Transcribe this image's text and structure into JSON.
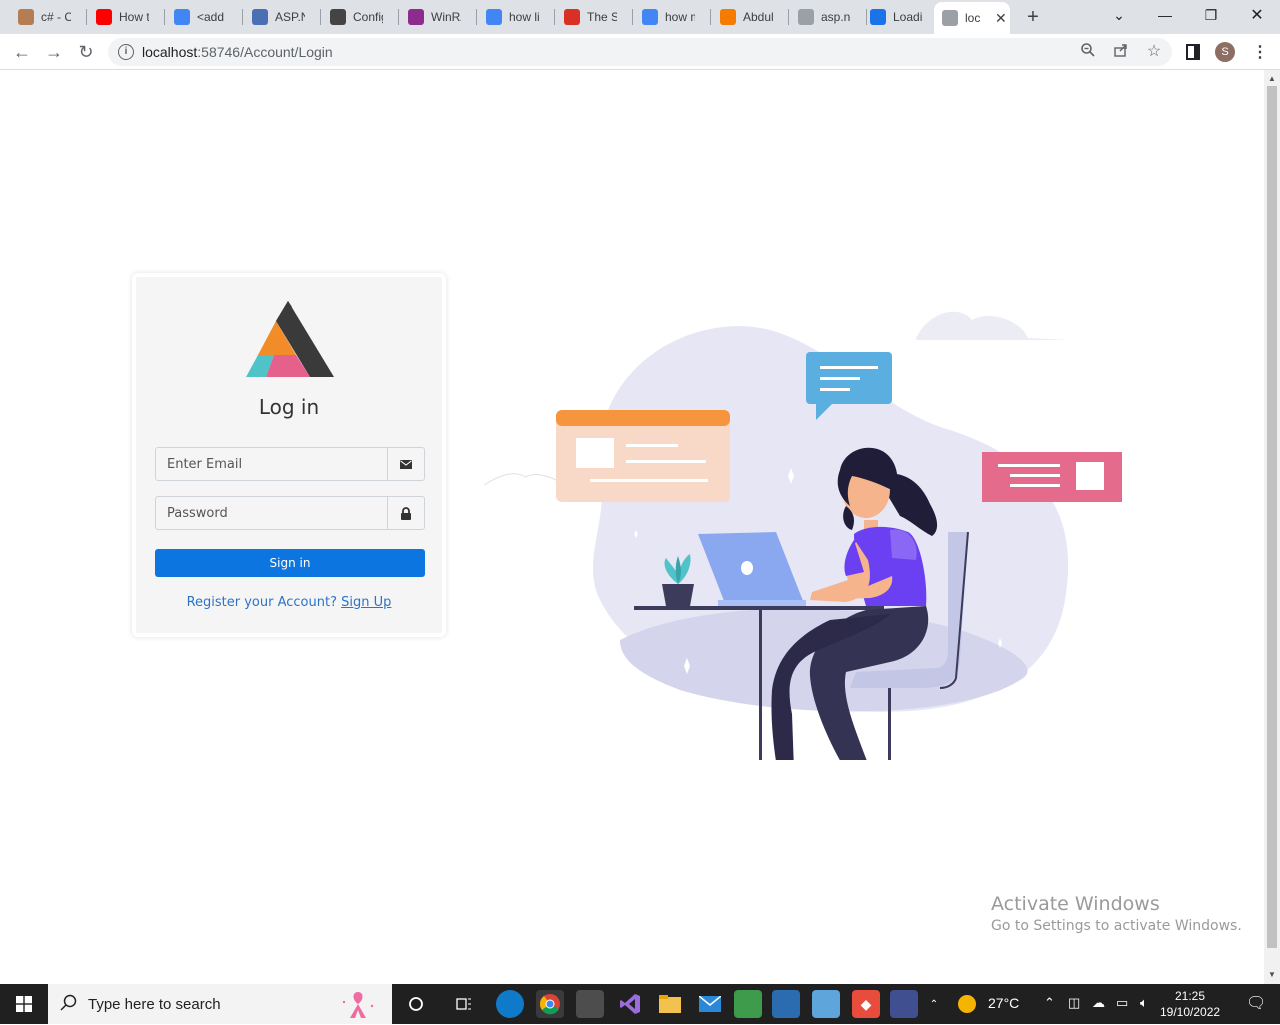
{
  "browser": {
    "tabs": [
      {
        "label": "c# - Co",
        "icon": "stackoverflow-icon",
        "color": "#b47d54"
      },
      {
        "label": "How to",
        "icon": "youtube-icon",
        "color": "#ff0000"
      },
      {
        "label": "<add r",
        "icon": "google-icon",
        "color": "#4285f4"
      },
      {
        "label": "ASP.NE",
        "icon": "aspnet-icon",
        "color": "#4a6fb3"
      },
      {
        "label": "Config",
        "icon": "vercel-icon",
        "color": "#444444"
      },
      {
        "label": "WinRA",
        "icon": "winrar-icon",
        "color": "#8e2b8e"
      },
      {
        "label": "how liv",
        "icon": "google-icon",
        "color": "#4285f4"
      },
      {
        "label": "The Sn",
        "icon": "snippet-icon",
        "color": "#d93025"
      },
      {
        "label": "how m",
        "icon": "google-icon",
        "color": "#4285f4"
      },
      {
        "label": "Abdul",
        "icon": "blogger-icon",
        "color": "#f57c00"
      },
      {
        "label": "asp.net",
        "icon": "stackoverflow-icon",
        "color": "#9aa0a6"
      },
      {
        "label": "Loadin",
        "icon": "loading-icon",
        "color": "#1a73e8"
      },
      {
        "label": "loc",
        "icon": "page-icon",
        "color": "#9aa0a6"
      }
    ],
    "url_host": "localhost",
    "url_rest": ":58746/Account/Login",
    "profile_initial": "S"
  },
  "login": {
    "title": "Log in",
    "email_placeholder": "Enter Email",
    "password_placeholder": "Password",
    "signin_label": "Sign in",
    "register_text": "Register your Account?",
    "signup_link": "Sign Up"
  },
  "watermark": {
    "line1": "Activate Windows",
    "line2": "Go to Settings to activate Windows."
  },
  "taskbar": {
    "search_placeholder": "Type here to search",
    "temperature": "27°C",
    "time": "21:25",
    "date": "19/10/2022"
  },
  "colors": {
    "primary_button": "#0d75e0",
    "link": "#2d73c8",
    "card_bg": "#f5f5f5"
  }
}
